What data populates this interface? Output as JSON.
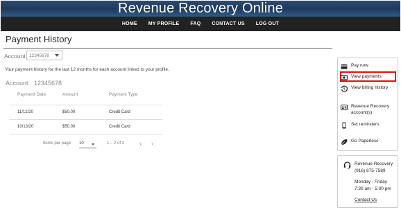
{
  "header": {
    "title": "Revenue Recovery Online",
    "nav": [
      "HOME",
      "MY PROFILE",
      "FAQ",
      "CONTACT US",
      "LOG OUT"
    ]
  },
  "page": {
    "title": "Payment History",
    "account_label": "Account",
    "account_selected": "12345678",
    "description": "Your payment history for the last 12 months for each account linked to your profile.",
    "account_heading_label": "Account",
    "account_heading_number": "12345678"
  },
  "table": {
    "columns": [
      "Payment Date",
      "Amount",
      "Payment Type"
    ],
    "rows": [
      [
        "11/12/20",
        "$50.00",
        "Credit Card"
      ],
      [
        "10/13/20",
        "$50.00",
        "Credit Card"
      ]
    ]
  },
  "pager": {
    "items_per_page_label": "Items per page:",
    "page_size": "10",
    "range": "1 – 2 of 2",
    "prev_glyph": "‹",
    "next_glyph": "›"
  },
  "sidebar": {
    "items": [
      {
        "label": "Pay now",
        "icon": "credit-card-icon"
      },
      {
        "label": "View payments",
        "icon": "money-icon",
        "highlighted": true
      },
      {
        "label": "View billing history",
        "icon": "history-icon"
      },
      {
        "label": "Revenue Recovery account(s)",
        "icon": "id-card-icon"
      },
      {
        "label": "Set reminders",
        "icon": "mobile-phone-icon"
      },
      {
        "label": "Go Paperless",
        "icon": "leaf-icon"
      }
    ],
    "highlight_color": "#e01010"
  },
  "contact": {
    "name": "Revenue Recovery",
    "phone": "(916) 875-7589",
    "hours_days": "Monday - Friday",
    "hours_time": "7:30 am - 5:00 pm",
    "link": "Contact Us",
    "icon": "headset-icon"
  },
  "colors": {
    "banner": "#1e3a5c",
    "navbar": "#222222"
  }
}
